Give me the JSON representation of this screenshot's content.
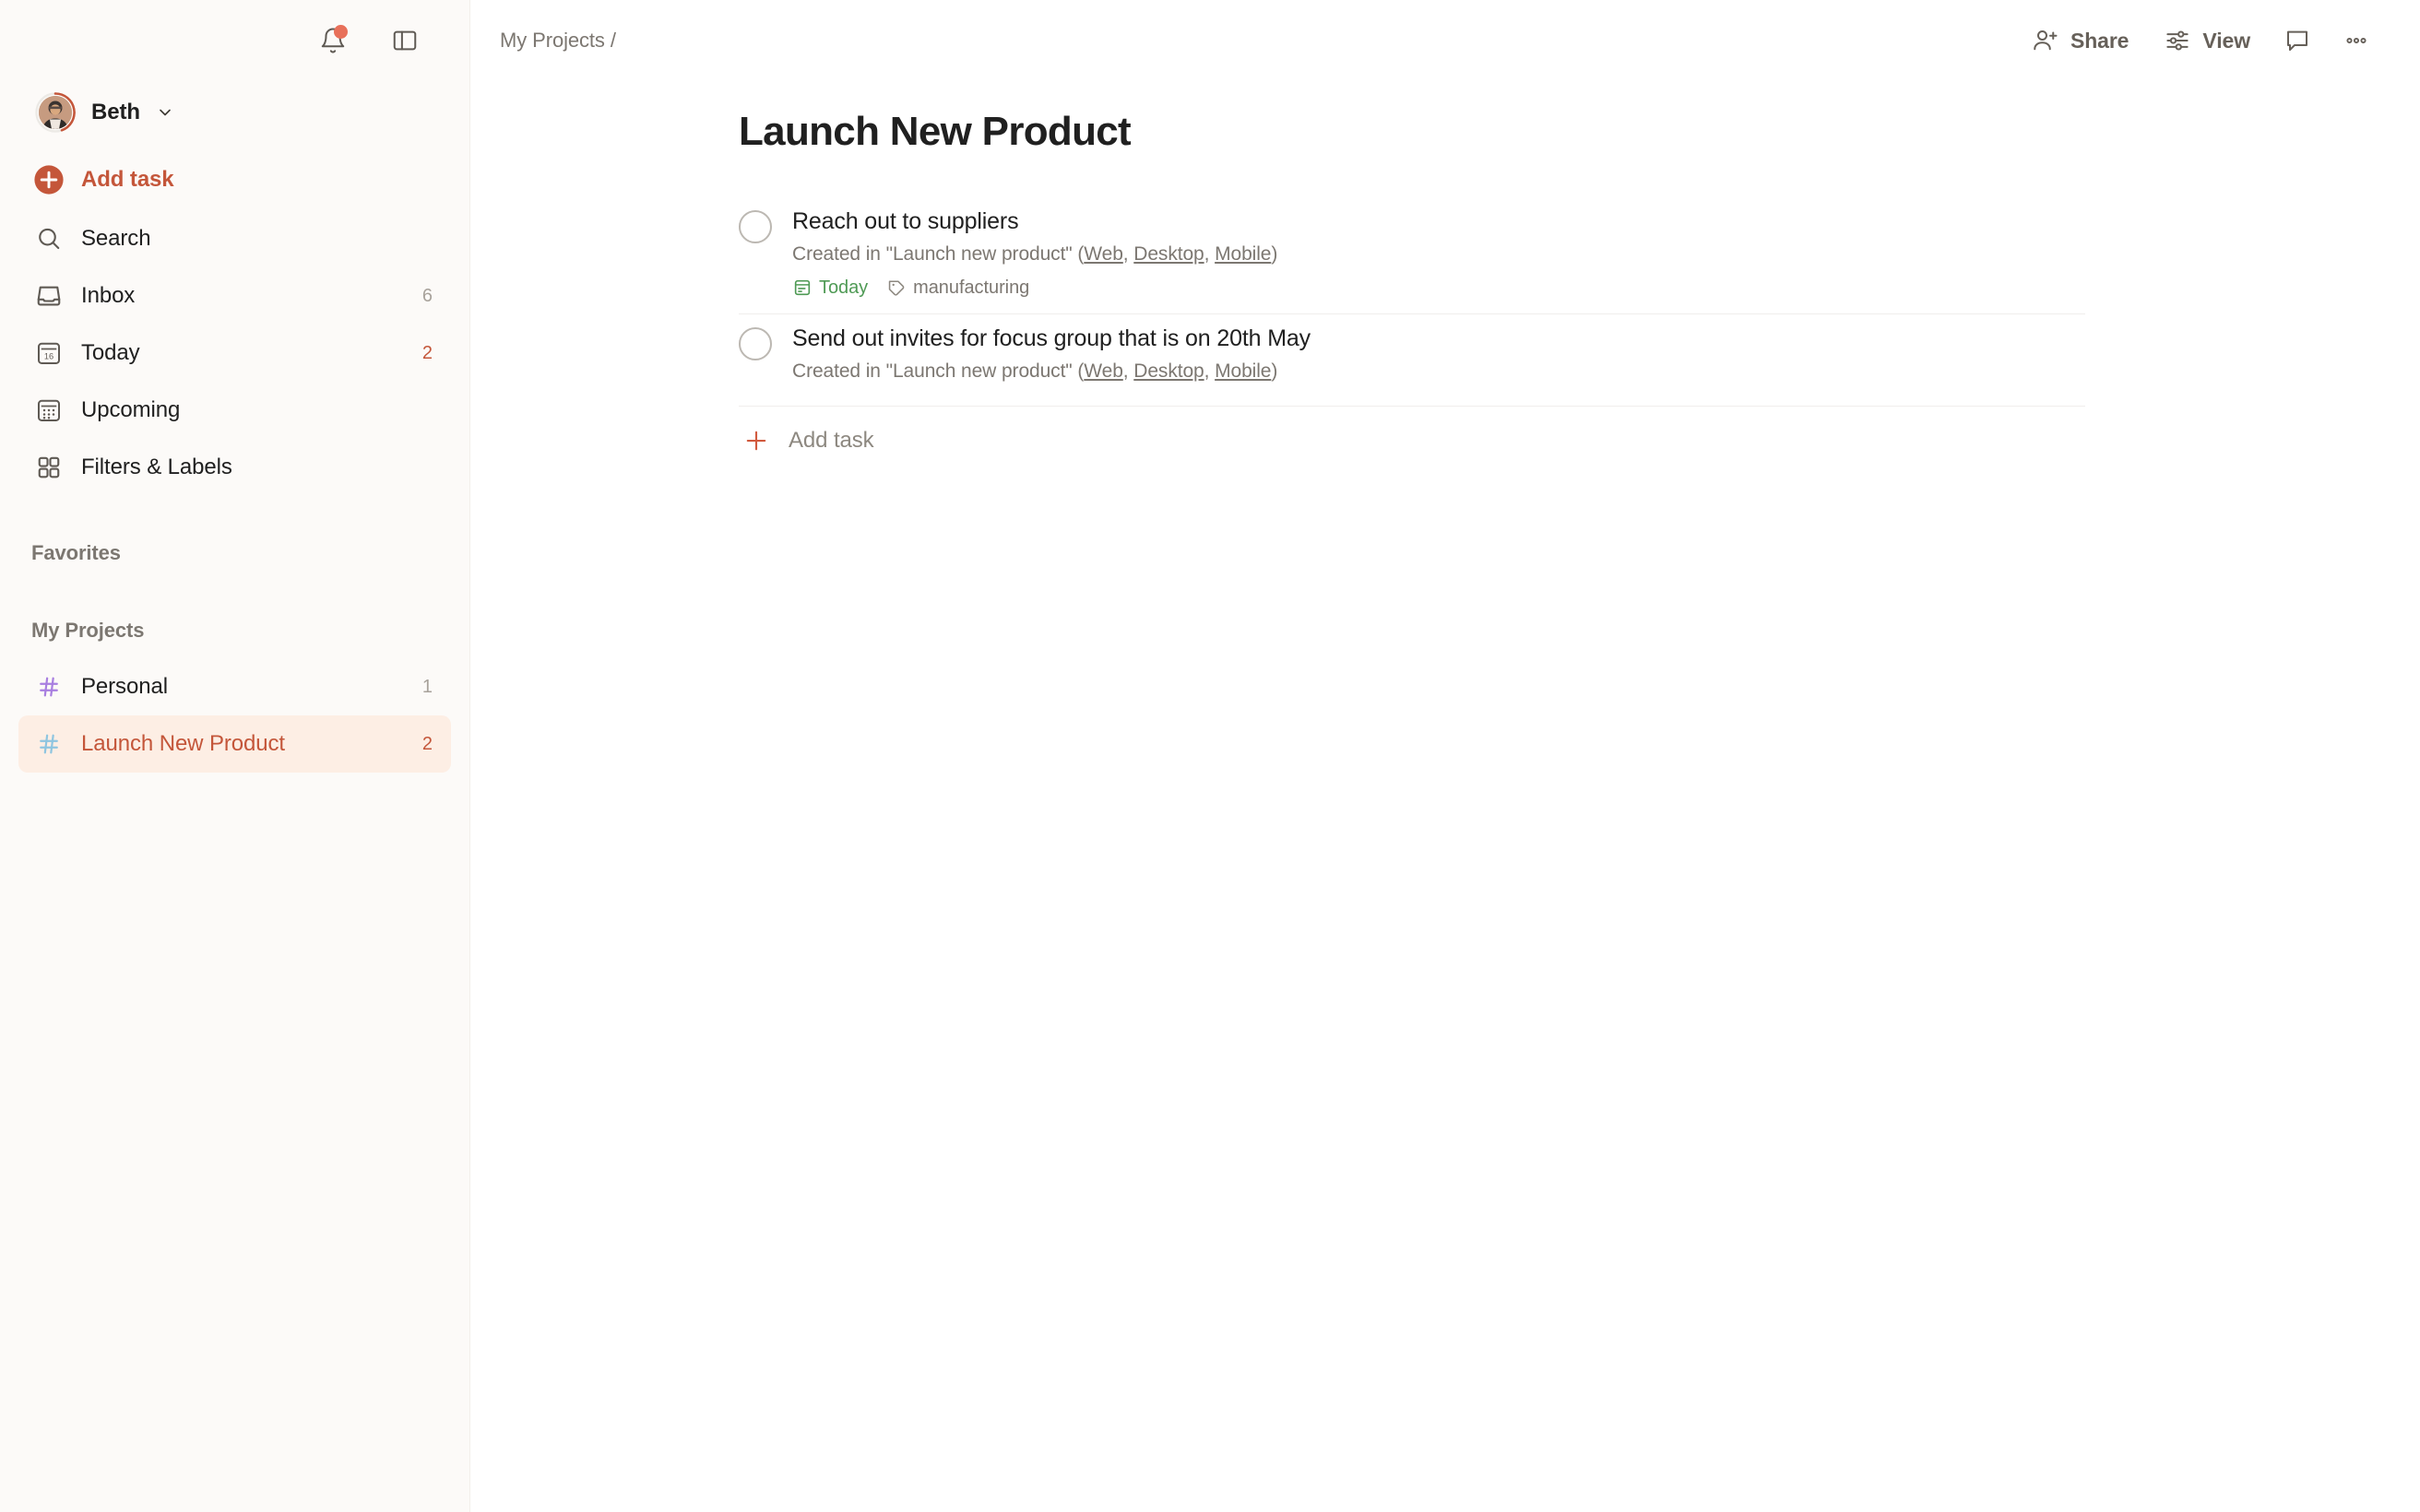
{
  "theme": {
    "accent": "#c4563a",
    "accent_dot": "#e8705a",
    "sidebar_bg": "#fcfaf8",
    "active_bg": "#fdeee4",
    "due_green": "#4f9a55",
    "muted": "#7c7771",
    "project_personal_hash": "#a87ee0",
    "project_launch_hash": "#8ec5e0"
  },
  "sidebar": {
    "notifications_icon": "bell-icon",
    "panel_toggle_icon": "sidebar-toggle-icon",
    "user": {
      "name": "Beth",
      "avatar_icon": "user-avatar",
      "chevron_icon": "chevron-down-icon"
    },
    "add_task": {
      "label": "Add task",
      "icon": "plus-circle-icon"
    },
    "nav": [
      {
        "label": "Search",
        "icon": "search-icon",
        "count": "",
        "count_accent": false,
        "active": false
      },
      {
        "label": "Inbox",
        "icon": "inbox-icon",
        "count": "6",
        "count_accent": false,
        "active": false
      },
      {
        "label": "Today",
        "icon": "today-icon",
        "count": "2",
        "count_accent": true,
        "active": false
      },
      {
        "label": "Upcoming",
        "icon": "upcoming-icon",
        "count": "",
        "count_accent": false,
        "active": false
      },
      {
        "label": "Filters & Labels",
        "icon": "filters-icon",
        "count": "",
        "count_accent": false,
        "active": false
      }
    ],
    "favorites_heading": "Favorites",
    "projects_heading": "My Projects",
    "projects": [
      {
        "label": "Personal",
        "icon": "hash-icon",
        "count": "1",
        "active": false
      },
      {
        "label": "Launch New Product",
        "icon": "hash-icon",
        "count": "2",
        "active": true
      }
    ]
  },
  "topbar": {
    "breadcrumb": "My Projects /",
    "share_label": "Share",
    "share_icon": "person-add-icon",
    "view_label": "View",
    "view_icon": "sliders-icon",
    "comments_icon": "comment-icon",
    "more_icon": "more-horizontal-icon"
  },
  "main": {
    "title": "Launch New Product",
    "tasks": [
      {
        "title": "Reach out to suppliers",
        "description_prefix": "Created in \"Launch new product\" (",
        "links": [
          "Web",
          "Desktop",
          "Mobile"
        ],
        "description_suffix": ")",
        "due": {
          "label": "Today",
          "icon": "calendar-due-icon"
        },
        "labels": [
          {
            "label": "manufacturing",
            "icon": "tag-icon"
          }
        ],
        "checkbox_icon": "checkbox-circle"
      },
      {
        "title": "Send out invites for focus group that is on 20th May",
        "description_prefix": "Created in \"Launch new product\" (",
        "links": [
          "Web",
          "Desktop",
          "Mobile"
        ],
        "description_suffix": ")",
        "due": null,
        "labels": [],
        "checkbox_icon": "checkbox-circle"
      }
    ],
    "add_task": {
      "label": "Add task",
      "icon": "plus-icon"
    }
  }
}
